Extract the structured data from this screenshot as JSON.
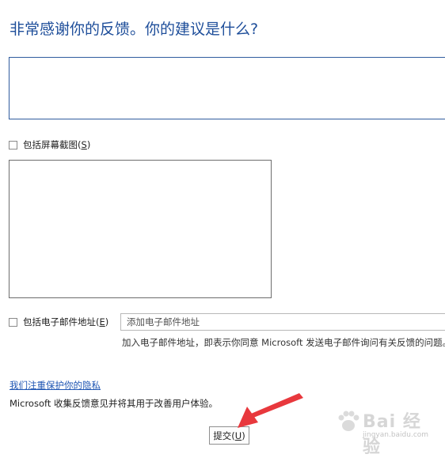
{
  "heading": "非常感谢你的反馈。你的建议是什么?",
  "screenshot_option": {
    "label": "包括屏幕截图(",
    "hotkey": "S",
    "label_end": ")"
  },
  "email_option": {
    "label": "包括电子邮件地址(",
    "hotkey": "E",
    "label_end": ")",
    "placeholder": "添加电子邮件地址",
    "note": "加入电子邮件地址，即表示你同意 Microsoft 发送电子邮件询问有关反馈的问题。"
  },
  "privacy_link": "我们注重保护你的隐私",
  "collect_note": "Microsoft 收集反馈意见并将其用于改善用户体验。",
  "submit": {
    "label": "提交(",
    "hotkey": "U",
    "label_end": ")"
  },
  "watermark": {
    "text": "Bai 经验",
    "sub": "jingyan.baidu.com"
  },
  "colors": {
    "heading": "#1e4e9a",
    "link": "#1f56b3",
    "arrow": "#e8383d"
  }
}
